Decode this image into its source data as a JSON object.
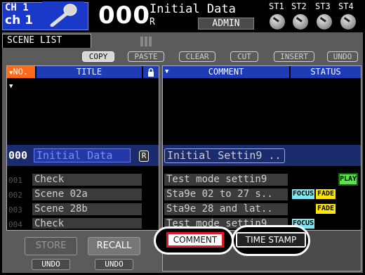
{
  "header": {
    "channel_line1": "CH 1",
    "channel_line2": "ch 1",
    "scene_number": "000",
    "scene_title": "Initial Data",
    "scene_r": "R",
    "user": "ADMIN",
    "stereo_labels": [
      "ST1",
      "ST2",
      "ST3",
      "ST4"
    ]
  },
  "tab": {
    "label": "SCENE LIST"
  },
  "toolbar": {
    "copy": "COPY",
    "paste": "PASTE",
    "clear": "CLEAR",
    "cut": "CUT",
    "insert": "INSERT",
    "undo": "UNDO"
  },
  "left_list": {
    "headers": {
      "no": "NO.",
      "title": "TITLE"
    },
    "selected": {
      "no": "000",
      "title": "Initial Data",
      "r": "R"
    },
    "rows": [
      {
        "no": "001",
        "title": "Check"
      },
      {
        "no": "002",
        "title": "Scene 02a"
      },
      {
        "no": "003",
        "title": "Scene 28b"
      },
      {
        "no": "004",
        "title": "Check"
      }
    ]
  },
  "right_list": {
    "headers": {
      "comment": "COMMENT",
      "status": "STATUS"
    },
    "selected": {
      "comment": "Initial Settin9 .."
    },
    "rows": [
      {
        "comment": "Test mode settin9",
        "status": [
          "PLAY"
        ]
      },
      {
        "comment": "Sta9e 02 to 27 s..",
        "status": [
          "FOCUS",
          "FADE"
        ]
      },
      {
        "comment": "Sta9e 28 and lat..",
        "status": [
          "FADE"
        ]
      },
      {
        "comment": "Test mode settin9",
        "status": [
          "FOCUS"
        ]
      }
    ]
  },
  "bottom": {
    "store": "STORE",
    "recall": "RECALL",
    "undo": "UNDO",
    "comment": "COMMENT",
    "time_stamp": "TIME STAMP"
  },
  "colors": {
    "header_blue": "#1a39c8",
    "column_header_blue": "#1d3cb6",
    "no_header_orange": "#ff6a1a",
    "focus_badge": "#7fe7f2",
    "fade_badge": "#ffe600",
    "play_badge": "#52e842",
    "comment_button_border": "#e6162a"
  }
}
